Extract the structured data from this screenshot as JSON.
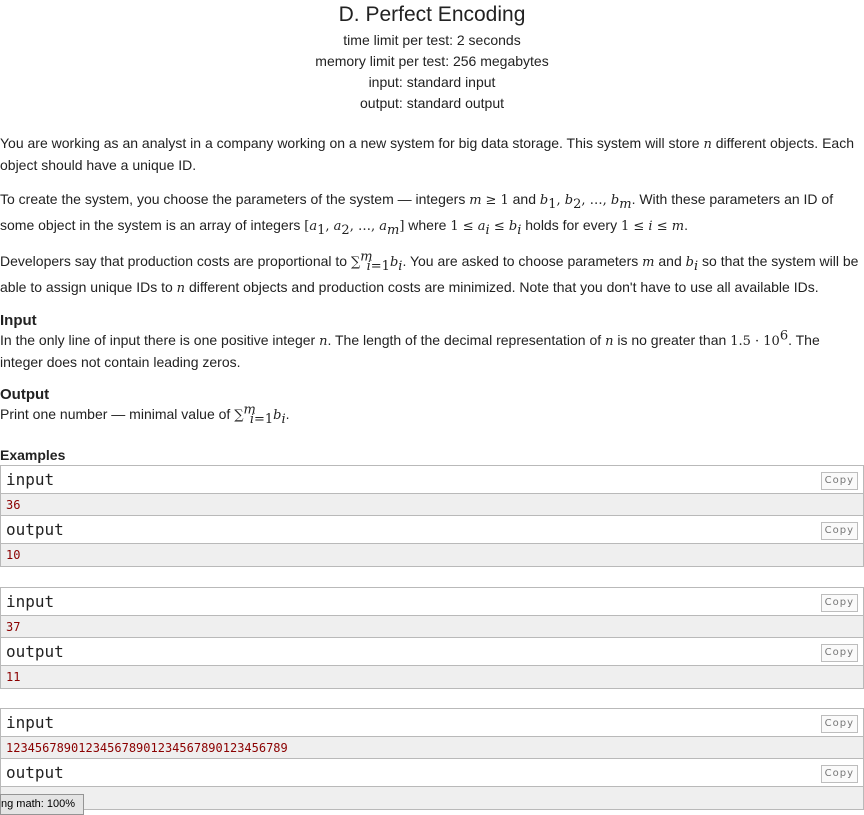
{
  "header": {
    "title": "D. Perfect Encoding",
    "time_limit": "time limit per test: 2 seconds",
    "memory_limit": "memory limit per test: 256 megabytes",
    "input": "input: standard input",
    "output": "output: standard output"
  },
  "statement": {
    "p1": "You are working as an analyst in a company working on a new system for big data storage. This system will store",
    "p1_var": "n",
    "p1_end": "different objects. Each object should have a unique ID.",
    "p2_a": "To create the system, you choose the parameters of the system — integers",
    "p2_m": "m ≥ 1",
    "p2_b": "and",
    "p2_bs": "b",
    "p2_c": ". With these parameters an ID of some object in the system is an array of integers",
    "p2_d": "where",
    "p2_e": "holds for every",
    "p3_a": "Developers say that production costs are proportional to",
    "p3_b": ". You are asked to choose parameters",
    "p3_m": "m",
    "p3_and": "and",
    "p3_c": "so that the system will be able to assign unique IDs to",
    "p3_n": "n",
    "p3_d": "different objects and production costs are minimized. Note that you don't have to use all available IDs."
  },
  "input_section": {
    "title": "Input",
    "text_a": "In the only line of input there is one positive integer",
    "text_n": "n",
    "text_b": ". The length of the decimal representation of",
    "text_c": "is no greater than",
    "limit": "1.5 · 10",
    "limit_exp": "6",
    "text_d": ". The integer does not contain leading zeros."
  },
  "output_section": {
    "title": "Output",
    "text": "Print one number — minimal value of"
  },
  "examples": {
    "title": "Examples",
    "copy_label": "Copy",
    "input_label": "input",
    "output_label": "output",
    "items": [
      {
        "input": "36",
        "output": "10"
      },
      {
        "input": "37",
        "output": "11"
      },
      {
        "input": "123456789012345678901234567890123456789",
        "output": ""
      }
    ]
  },
  "status": {
    "text": "ng math: 100%"
  }
}
